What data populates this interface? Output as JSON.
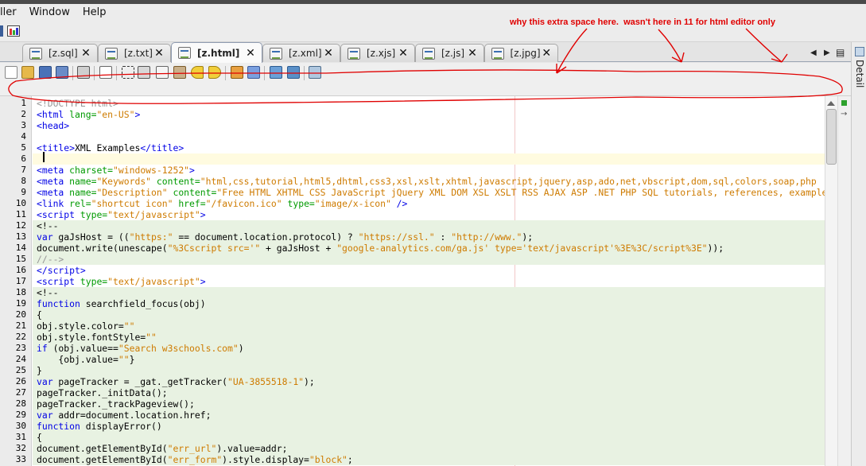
{
  "menu": {
    "items": [
      "ller",
      "Window",
      "Help"
    ]
  },
  "tabs": [
    {
      "label": "[z.sql]",
      "active": false
    },
    {
      "label": "[z.txt]",
      "active": false
    },
    {
      "label": "[z.html]",
      "active": true
    },
    {
      "label": "[z.xml]",
      "active": false
    },
    {
      "label": "[z.xjs]",
      "active": false
    },
    {
      "label": "[z.js]",
      "active": false
    },
    {
      "label": "[z.jpg]",
      "active": false
    }
  ],
  "tab_close_glyph": "✕",
  "sidebar": {
    "label": "Detail"
  },
  "annotation": {
    "text": "why this extra space here.  wasn't here in 11 for html editor only",
    "color": "#e00000"
  },
  "editor": {
    "lines": [
      {
        "n": "1",
        "html": "<span class=\"c\">&lt;!DOCTYPE html&gt;</span>",
        "bg": ""
      },
      {
        "n": "2",
        "html": "<span class=\"t\">&lt;html</span> <span class=\"a\">lang=</span><span class=\"v\">\"en-US\"</span><span class=\"t\">&gt;</span>",
        "bg": ""
      },
      {
        "n": "3",
        "html": "<span class=\"t\">&lt;head&gt;</span>",
        "bg": ""
      },
      {
        "n": "4",
        "html": "",
        "bg": ""
      },
      {
        "n": "5",
        "html": "<span class=\"t\">&lt;title&gt;</span>XML Examples<span class=\"t\">&lt;/title&gt;</span>",
        "bg": ""
      },
      {
        "n": "6",
        "html": "",
        "bg": "cur"
      },
      {
        "n": "7",
        "html": "<span class=\"t\">&lt;meta</span> <span class=\"a\">charset=</span><span class=\"v\">\"windows-1252\"</span><span class=\"t\">&gt;</span>",
        "bg": ""
      },
      {
        "n": "8",
        "html": "<span class=\"t\">&lt;meta</span> <span class=\"a\">name=</span><span class=\"v\">\"Keywords\"</span> <span class=\"a\">content=</span><span class=\"v\">\"html,css,tutorial,html5,dhtml,css3,xsl,xslt,xhtml,javascript,jquery,asp,ado,net,vbscript,dom,sql,colors,soap,php</span>",
        "bg": ""
      },
      {
        "n": "9",
        "html": "<span class=\"t\">&lt;meta</span> <span class=\"a\">name=</span><span class=\"v\">\"Description\"</span> <span class=\"a\">content=</span><span class=\"v\">\"Free HTML XHTML CSS JavaScript jQuery XML DOM XSL XSLT RSS AJAX ASP .NET PHP SQL tutorials, references, examples</span>",
        "bg": ""
      },
      {
        "n": "10",
        "html": "<span class=\"t\">&lt;link</span> <span class=\"a\">rel=</span><span class=\"v\">\"shortcut icon\"</span> <span class=\"a\">href=</span><span class=\"v\">\"/favicon.ico\"</span> <span class=\"a\">type=</span><span class=\"v\">\"image/x-icon\"</span> <span class=\"t\">/&gt;</span>",
        "bg": ""
      },
      {
        "n": "11",
        "html": "<span class=\"t\">&lt;script</span> <span class=\"a\">type=</span><span class=\"v\">\"text/javascript\"</span><span class=\"t\">&gt;</span>",
        "bg": ""
      },
      {
        "n": "12",
        "html": "&lt;!--",
        "bg": "js"
      },
      {
        "n": "13",
        "html": "<span class=\"k\">var</span> gaJsHost = ((<span class=\"s\">\"https:\"</span> == document.location.protocol) ? <span class=\"s\">\"https://ssl.\"</span> : <span class=\"s\">\"http://www.\"</span>);",
        "bg": "js"
      },
      {
        "n": "14",
        "html": "document.write(unescape(<span class=\"s\">\"%3Cscript src='\"</span> + gaJsHost + <span class=\"s\">\"google-analytics.com/ga.js' type='text/javascript'%3E%3C/script%3E\"</span>));",
        "bg": "js"
      },
      {
        "n": "15",
        "html": "<span class=\"c\">//--&gt;</span>",
        "bg": "js"
      },
      {
        "n": "16",
        "html": "<span class=\"t\">&lt;/script&gt;</span>",
        "bg": ""
      },
      {
        "n": "17",
        "html": "<span class=\"t\">&lt;script</span> <span class=\"a\">type=</span><span class=\"v\">\"text/javascript\"</span><span class=\"t\">&gt;</span>",
        "bg": ""
      },
      {
        "n": "18",
        "html": "&lt;!--",
        "bg": "js"
      },
      {
        "n": "19",
        "html": "<span class=\"k\">function</span> searchfield_focus(obj)",
        "bg": "js"
      },
      {
        "n": "20",
        "html": "{",
        "bg": "js"
      },
      {
        "n": "21",
        "html": "obj.style.color=<span class=\"s\">\"\"</span>",
        "bg": "js"
      },
      {
        "n": "22",
        "html": "obj.style.fontStyle=<span class=\"s\">\"\"</span>",
        "bg": "js"
      },
      {
        "n": "23",
        "html": "<span class=\"k\">if</span> (obj.value==<span class=\"s\">\"Search w3schools.com\"</span>)",
        "bg": "js"
      },
      {
        "n": "24",
        "html": "    {obj.value=<span class=\"s\">\"\"</span>}",
        "bg": "js"
      },
      {
        "n": "25",
        "html": "}",
        "bg": "js"
      },
      {
        "n": "26",
        "html": "<span class=\"k\">var</span> pageTracker = _gat._getTracker(<span class=\"s\">\"UA-3855518-1\"</span>);",
        "bg": "js"
      },
      {
        "n": "27",
        "html": "pageTracker._initData();",
        "bg": "js"
      },
      {
        "n": "28",
        "html": "pageTracker._trackPageview();",
        "bg": "js"
      },
      {
        "n": "29",
        "html": "<span class=\"k\">var</span> addr=document.location.href;",
        "bg": "js"
      },
      {
        "n": "30",
        "html": "<span class=\"k\">function</span> displayError()",
        "bg": "js"
      },
      {
        "n": "31",
        "html": "{",
        "bg": "js"
      },
      {
        "n": "32",
        "html": "document.getElementById(<span class=\"s\">\"err_url\"</span>).value=addr;",
        "bg": "js"
      },
      {
        "n": "33",
        "html": "document.getElementById(<span class=\"s\">\"err_form\"</span>).style.display=<span class=\"s\">\"block\"</span>;",
        "bg": "js"
      }
    ]
  }
}
